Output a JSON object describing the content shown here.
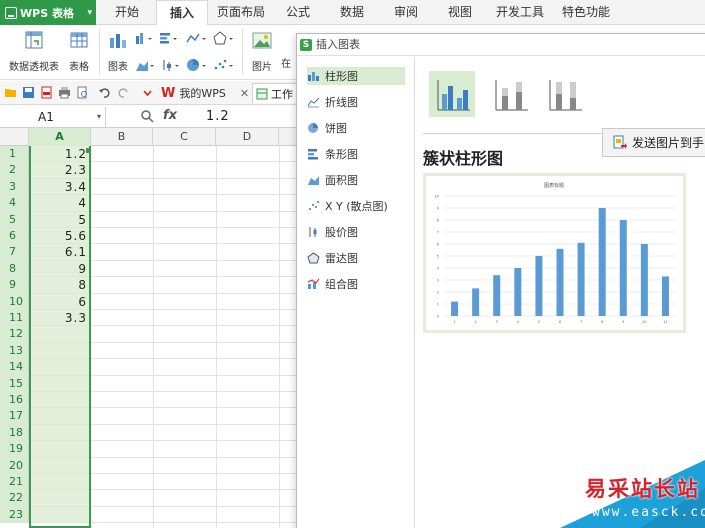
{
  "app": {
    "name": "WPS 表格",
    "menu_tabs": [
      "开始",
      "插入",
      "页面布局",
      "公式",
      "数据",
      "审阅",
      "视图",
      "开发工具",
      "特色功能"
    ],
    "active_tab": "插入"
  },
  "ribbon": {
    "pivot_label": "数据透视表",
    "table_label": "表格",
    "chart_label": "图表",
    "picture_label": "图片",
    "picture_label2": "在"
  },
  "tabs": {
    "wps": "我的WPS",
    "workbook": "工作"
  },
  "formula": {
    "cell_ref": "A1",
    "fx": "fx",
    "value": "1.2"
  },
  "sheet": {
    "columns": [
      "A",
      "B",
      "C",
      "D"
    ],
    "rows": [
      "1",
      "2",
      "3",
      "4",
      "5",
      "6",
      "7",
      "8",
      "9",
      "10",
      "11",
      "12",
      "13",
      "14",
      "15",
      "16",
      "17",
      "18",
      "19",
      "20",
      "21",
      "22",
      "23"
    ],
    "colA": [
      "1.2",
      "2.3",
      "3.4",
      "4",
      "5",
      "5.6",
      "6.1",
      "9",
      "8",
      "6",
      "3.3"
    ]
  },
  "dialog": {
    "title": "插入图表",
    "chart_types": [
      "柱形图",
      "折线图",
      "饼图",
      "条形图",
      "面积图",
      "X Y (散点图)",
      "股价图",
      "雷达图",
      "组合图"
    ],
    "selected_type": "柱形图",
    "subtype_title": "簇状柱形图",
    "send_button": "发送图片到手"
  },
  "chart_data": {
    "type": "bar",
    "title": "图表标题",
    "categories": [
      "1",
      "2",
      "3",
      "4",
      "5",
      "6",
      "7",
      "8",
      "9",
      "10",
      "11"
    ],
    "values": [
      1.2,
      2.3,
      3.4,
      4,
      5,
      5.6,
      6.1,
      9,
      8,
      6,
      3.3
    ],
    "ylim": [
      0,
      10
    ],
    "yticks": [
      "0",
      "1",
      "2",
      "3",
      "4",
      "5",
      "6",
      "7",
      "8",
      "9",
      "10"
    ],
    "bar_color": "#5b9bd5",
    "grid": true
  },
  "watermark": {
    "text": "易采站长站",
    "url": "www.easck.com"
  },
  "colors": {
    "accent": "#2e9a49",
    "selection": "#d7ecd0",
    "bar": "#5b9bd5",
    "watermark_bg": "#1da1d8"
  }
}
